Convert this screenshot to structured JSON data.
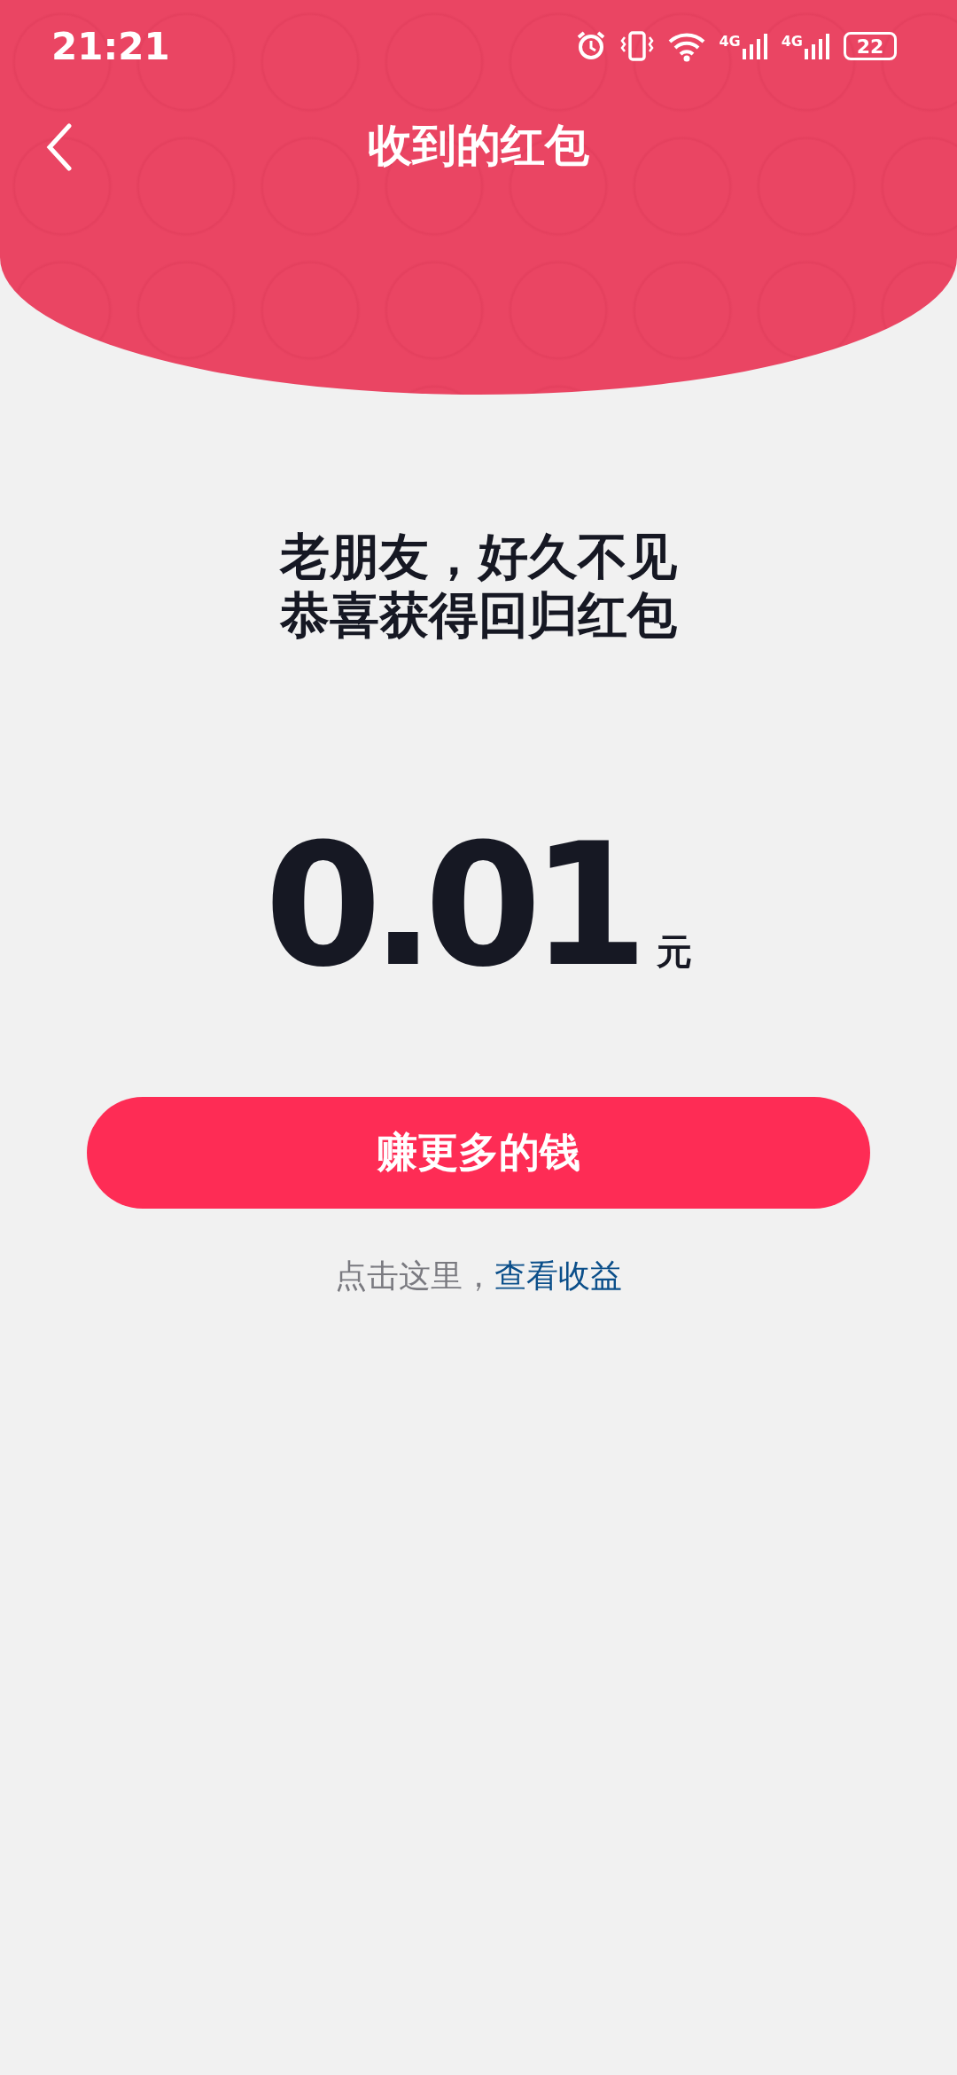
{
  "status_bar": {
    "time": "21:21",
    "network_labels": [
      "4G",
      "4G"
    ],
    "battery": "22"
  },
  "header": {
    "title": "收到的红包"
  },
  "greeting": [
    "老朋友，好久不见",
    "恭喜获得回归红包"
  ],
  "amount": {
    "value": "0.01",
    "unit": "元"
  },
  "button": "赚更多的钱",
  "footer": {
    "text": "点击这里，",
    "link": "查看收益"
  }
}
